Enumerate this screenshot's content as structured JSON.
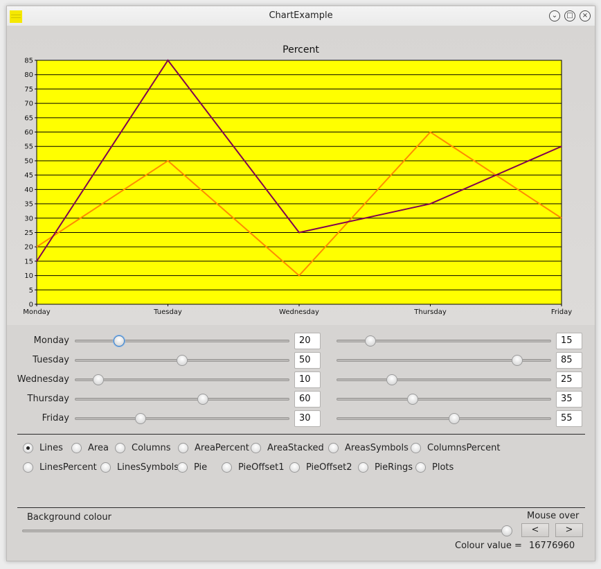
{
  "window": {
    "title": "ChartExample"
  },
  "chart_data": {
    "type": "line",
    "title": "Percent",
    "categories": [
      "Monday",
      "Tuesday",
      "Wednesday",
      "Thursday",
      "Friday"
    ],
    "series": [
      {
        "values": [
          20,
          50,
          10,
          60,
          30
        ],
        "color": "#ff8c00"
      },
      {
        "values": [
          15,
          85,
          25,
          35,
          55
        ],
        "color": "#800050"
      }
    ],
    "ylim": [
      0,
      85
    ],
    "yticks": [
      0,
      5,
      10,
      15,
      20,
      25,
      30,
      35,
      40,
      45,
      50,
      55,
      60,
      65,
      70,
      75,
      80,
      85
    ],
    "grid": true,
    "plot_background": "#ffff00"
  },
  "sliders": {
    "rows": [
      {
        "label": "Monday",
        "left_value": "20",
        "right_value": "15"
      },
      {
        "label": "Tuesday",
        "left_value": "50",
        "right_value": "85"
      },
      {
        "label": "Wednesday",
        "left_value": "10",
        "right_value": "25"
      },
      {
        "label": "Thursday",
        "left_value": "60",
        "right_value": "35"
      },
      {
        "label": "Friday",
        "left_value": "30",
        "right_value": "55"
      }
    ],
    "max": 100
  },
  "chart_types": {
    "options": [
      "Lines",
      "Area",
      "Columns",
      "AreaPercent",
      "AreaStacked",
      "AreasSymbols",
      "ColumnsPercent",
      "LinesPercent",
      "LinesSymbols",
      "Pie",
      "PieOffset1",
      "PieOffset2",
      "PieRings",
      "Plots"
    ],
    "selected": "Lines"
  },
  "background": {
    "label": "Background colour",
    "slider_fraction": 0.999,
    "mouse_over_label": "Mouse over",
    "prev_button": "<",
    "next_button": ">",
    "colour_value_label": "Colour value =",
    "colour_value": "16776960"
  }
}
